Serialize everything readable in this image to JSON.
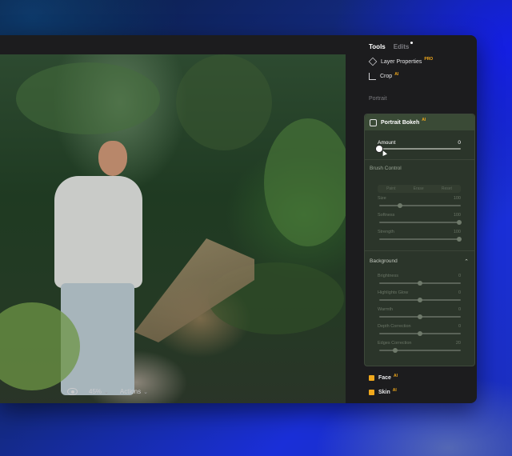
{
  "panel": {
    "tabs": [
      {
        "label": "Tools",
        "active": true
      },
      {
        "label": "Edits",
        "active": false
      }
    ],
    "menu": [
      {
        "label": "Layer Properties",
        "badge": "PRO",
        "icon": "layers-icon"
      },
      {
        "label": "Crop",
        "badge": "AI",
        "icon": "crop-icon"
      }
    ],
    "section_label": "Portrait",
    "bokeh": {
      "title": "Portrait Bokeh",
      "badge": "AI",
      "amount_label": "Amount",
      "amount_value": "0",
      "amount_fraction": 0.0,
      "brush_control_label": "Brush Control",
      "brush_mode_tabs": [
        "Paint",
        "Erase",
        "Reset"
      ],
      "brush_rows": [
        {
          "label": "Size",
          "value": "100",
          "fraction": 0.25
        },
        {
          "label": "Softness",
          "value": "100",
          "fraction": 0.98
        },
        {
          "label": "Strength",
          "value": "100",
          "fraction": 0.98
        }
      ],
      "background_label": "Background",
      "background_rows": [
        {
          "label": "Brightness",
          "value": "0",
          "fraction": 0.5
        },
        {
          "label": "Highlights Glow",
          "value": "0",
          "fraction": 0.5
        },
        {
          "label": "Warmth",
          "value": "0",
          "fraction": 0.5
        },
        {
          "label": "Depth Correction",
          "value": "0",
          "fraction": 0.5
        },
        {
          "label": "Edges Correction",
          "value": "20",
          "fraction": 0.2
        }
      ]
    },
    "bottom_items": [
      {
        "label": "Face",
        "badge": "AI"
      },
      {
        "label": "Skin",
        "badge": "AI"
      }
    ]
  },
  "toolbar": {
    "zoom": "45%",
    "actions_label": "Actions"
  },
  "colors": {
    "accent_badge": "#f0a81c",
    "panel_bg": "#1c1c1e",
    "bokeh_bg": "#2b352a"
  }
}
